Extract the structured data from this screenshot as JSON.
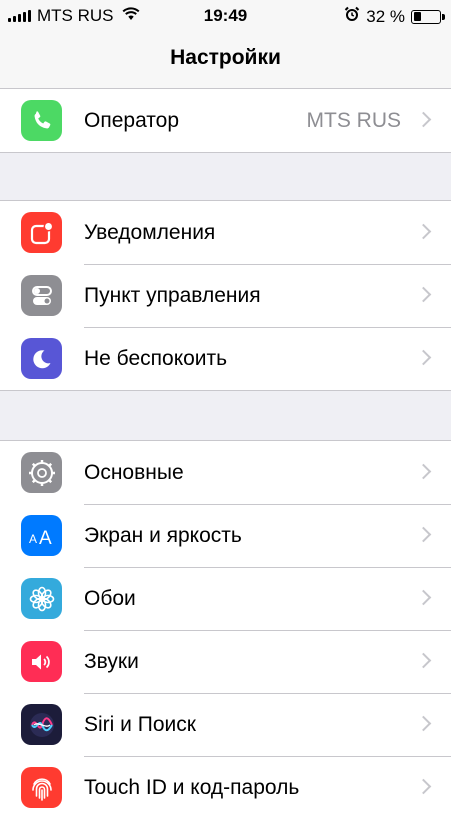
{
  "status_bar": {
    "carrier": "MTS RUS",
    "time": "19:49",
    "battery_percent": "32 %",
    "battery_level": 0.32,
    "icons": [
      "signal-icon",
      "wifi-icon",
      "alarm-icon",
      "battery-icon"
    ]
  },
  "nav": {
    "title": "Настройки"
  },
  "groups": [
    {
      "items": [
        {
          "label": "Оператор",
          "value": "MTS RUS",
          "icon": "phone-icon",
          "color": "#4cd964"
        }
      ]
    },
    {
      "items": [
        {
          "label": "Уведомления",
          "icon": "notifications-icon",
          "color": "#ff3b30"
        },
        {
          "label": "Пункт управления",
          "icon": "control-center-icon",
          "color": "#8e8e93"
        },
        {
          "label": "Не беспокоить",
          "icon": "moon-icon",
          "color": "#5856d6"
        }
      ]
    },
    {
      "items": [
        {
          "label": "Основные",
          "icon": "gear-icon",
          "color": "#8e8e93"
        },
        {
          "label": "Экран и яркость",
          "icon": "display-brightness-icon",
          "color": "#007aff"
        },
        {
          "label": "Обои",
          "icon": "wallpaper-flower-icon",
          "color": "#34aadc"
        },
        {
          "label": "Звуки",
          "icon": "speaker-icon",
          "color": "#ff2d55"
        },
        {
          "label": "Siri и Поиск",
          "icon": "siri-icon",
          "color": "#1c1c3a"
        },
        {
          "label": "Touch ID и код-пароль",
          "icon": "fingerprint-icon",
          "color": "#ff3b30"
        }
      ]
    }
  ]
}
